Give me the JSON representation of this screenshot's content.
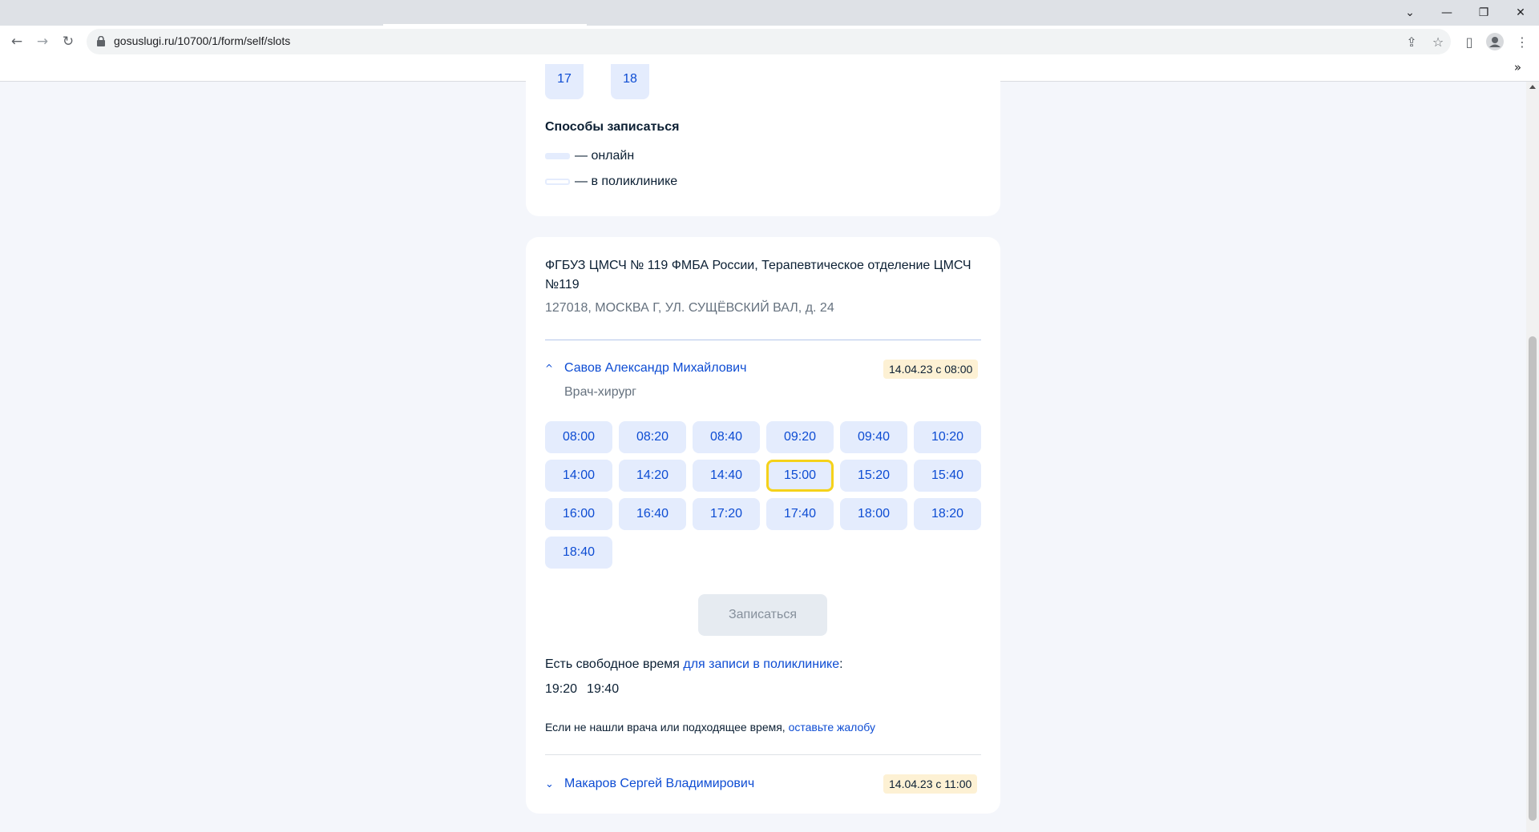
{
  "browser": {
    "url": "gosuslugi.ru/10700/1/form/self/slots",
    "more_chevron": "»"
  },
  "legend": {
    "title": "Способы записаться",
    "online": "— онлайн",
    "clinic": "— в поликлинике"
  },
  "partial_chips": [
    "17",
    "18"
  ],
  "clinic": {
    "name": "ФГБУЗ ЦМСЧ № 119 ФМБА России, Терапевтическое отделение ЦМСЧ №119",
    "address": "127018, МОСКВА Г, УЛ. СУЩЁВСКИЙ ВАЛ, д. 24"
  },
  "doctors": [
    {
      "name": "Савов Александр Михайлович",
      "role": "Врач-хирург",
      "badge": "14.04.23 с 08:00",
      "expanded": true
    },
    {
      "name": "Макаров Сергей Владимирович",
      "badge": "14.04.23 с 11:00",
      "expanded": false
    }
  ],
  "slots": [
    "08:00",
    "08:20",
    "08:40",
    "09:20",
    "09:40",
    "10:20",
    "14:00",
    "14:20",
    "14:40",
    "15:00",
    "15:20",
    "15:40",
    "16:00",
    "16:40",
    "17:20",
    "17:40",
    "18:00",
    "18:20",
    "18:40"
  ],
  "selected_slot": "15:00",
  "submit_label": "Записаться",
  "free_time": {
    "prefix": "Есть свободное время ",
    "link": "для записи в поликлинике",
    "suffix": ":",
    "times": [
      "19:20",
      "19:40"
    ]
  },
  "complaint": {
    "prefix": "Если не нашли врача или подходящее время, ",
    "link": "оставьте жалобу"
  },
  "colors": {
    "accent": "#0d4cd3",
    "slot_bg": "#e4ecfd",
    "selected_border": "#f5d21a",
    "badge_bg": "#fdf1d4"
  }
}
